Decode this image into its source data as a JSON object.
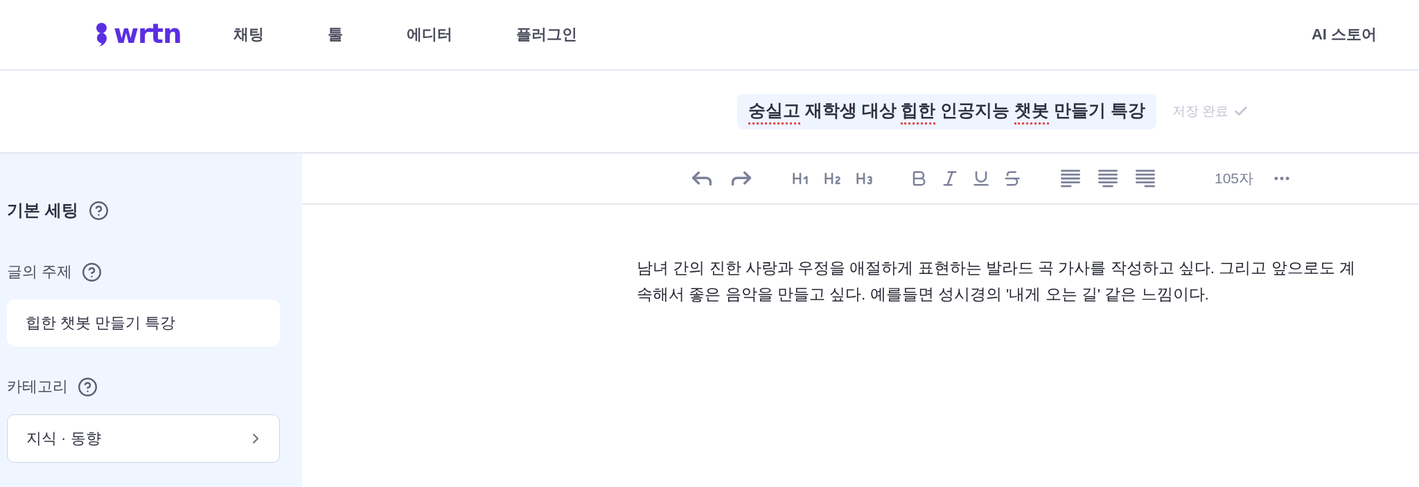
{
  "header": {
    "logo": {
      "text": "wrtn"
    },
    "nav": [
      "채팅",
      "툴",
      "에디터",
      "플러그인"
    ],
    "store_link": "AI 스토어"
  },
  "document": {
    "title_parts": [
      {
        "text": "숭실고",
        "spellcheck_flag": true
      },
      {
        "text": "재학생 대상",
        "spellcheck_flag": false
      },
      {
        "text": "힙한",
        "spellcheck_flag": true
      },
      {
        "text": "인공지능",
        "spellcheck_flag": false
      },
      {
        "text": "챗봇",
        "spellcheck_flag": true
      },
      {
        "text": "만들기 특강",
        "spellcheck_flag": false
      }
    ],
    "save_status": {
      "text": "저장 완료",
      "done": true
    }
  },
  "settings": {
    "title": "기본 세팅",
    "fields": [
      {
        "kind": "text",
        "label": "글의 주제",
        "value": "힙한 챗봇 만들기 특강"
      },
      {
        "kind": "select",
        "label": "카테고리",
        "value": "지식 · 동향"
      }
    ]
  },
  "editor": {
    "toolbar": {
      "char_count": "105자"
    },
    "body": "남녀 간의 진한 사랑과 우정을 애절하게 표현하는 발라드 곡 가사를 작성하고 싶다. 그리고 앞으로도 계속해서 좋은 음악을 만들고 싶다. 예를들면 성시경의 '내게 오는 길' 같은 느낌이다."
  }
}
